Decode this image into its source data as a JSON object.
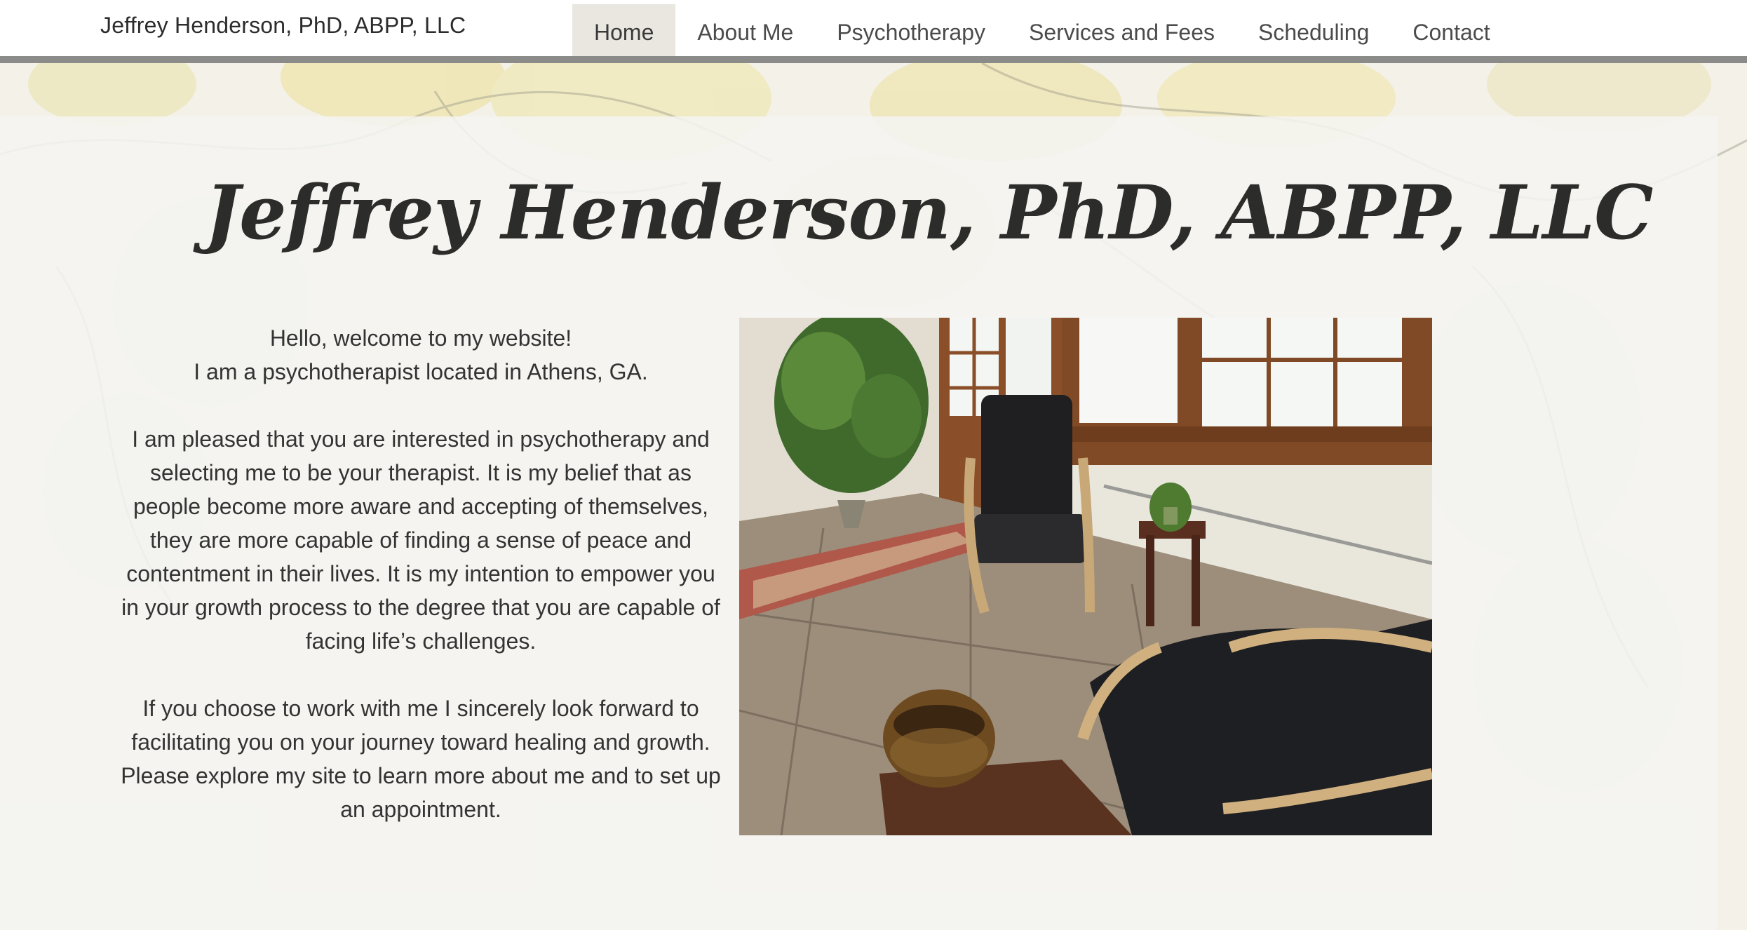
{
  "header": {
    "site_name": "Jeffrey Henderson, PhD, ABPP, LLC"
  },
  "nav": {
    "items": [
      {
        "label": "Home",
        "active": true
      },
      {
        "label": "About Me",
        "active": false
      },
      {
        "label": "Psychotherapy",
        "active": false
      },
      {
        "label": "Services and Fees",
        "active": false
      },
      {
        "label": "Scheduling",
        "active": false
      },
      {
        "label": "Contact",
        "active": false
      }
    ]
  },
  "hero": {
    "title": "Jeffrey Henderson, PhD, ABPP, LLC"
  },
  "intro": {
    "welcome": "Hello, welcome to my website!",
    "location": "I am a psychotherapist located in Athens, GA.",
    "paragraph_1": "I am pleased that you are interested in psychotherapy and selecting me to be your therapist. It is my belief that as people become more aware and accepting of themselves, they are more capable of finding a sense of peace and contentment in their lives. It is my intention to empower you in your growth process to the degree that you are capable of facing life’s challenges.",
    "paragraph_2": "If you choose to work with me I sincerely look forward to facilitating you on your journey toward healing and growth. Please explore my site to learn more about me and to set up an appointment."
  },
  "colors": {
    "header_bg": "#ffffff",
    "header_rule": "#8b8b89",
    "nav_active_bg": "#e9e7e0",
    "text": "#333333",
    "title": "#2c2c2a",
    "panel_bg": "#f4f4f2"
  }
}
